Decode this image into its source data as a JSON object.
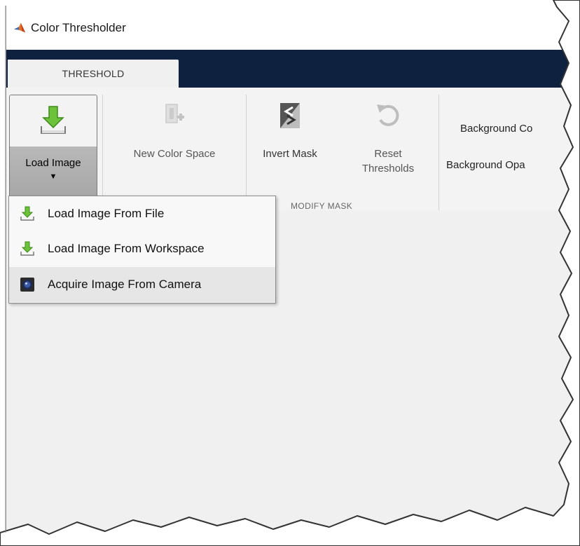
{
  "window": {
    "title": "Color Thresholder",
    "app_icon": "matlab-logo-icon"
  },
  "tabs": [
    {
      "label": "THRESHOLD",
      "active": true
    }
  ],
  "ribbon": {
    "load_image": {
      "label": "Load Image",
      "caret": "▼",
      "icon": "load-arrow-icon"
    },
    "new_color_space": {
      "label": "New Color Space",
      "icon": "new-color-space-icon",
      "enabled": false
    },
    "invert_mask": {
      "label": "Invert Mask",
      "icon": "invert-mask-icon"
    },
    "reset_thresholds": {
      "label_line1": "Reset",
      "label_line2": "Thresholds",
      "icon": "reset-icon"
    },
    "group_modify_mask": "MODIFY MASK",
    "background_color_label": "Background Co",
    "background_opacity_label": "Background Opa"
  },
  "load_menu": {
    "items": [
      {
        "label": "Load Image From File",
        "icon": "load-arrow-icon"
      },
      {
        "label": "Load Image From Workspace",
        "icon": "load-arrow-icon"
      },
      {
        "label": "Acquire Image From Camera",
        "icon": "camera-icon",
        "highlighted": true
      }
    ]
  },
  "colors": {
    "tabstrip": "#0e2240",
    "accent_green": "#5fb82d"
  }
}
